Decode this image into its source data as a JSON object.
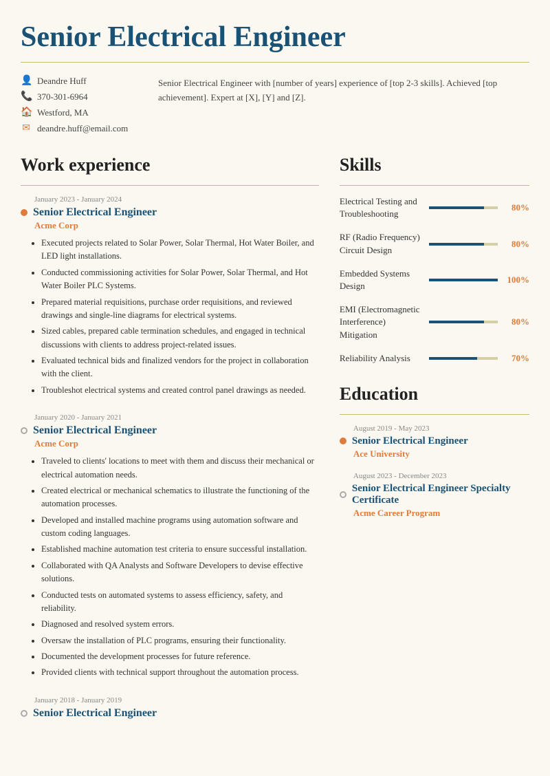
{
  "page": {
    "title": "Senior Electrical Engineer"
  },
  "contact": {
    "name": "Deandre Huff",
    "phone": "370-301-6964",
    "location": "Westford, MA",
    "email": "deandre.huff@email.com"
  },
  "summary": "Senior Electrical Engineer with [number of years] experience of [top 2-3 skills]. Achieved [top achievement]. Expert at [X], [Y] and [Z].",
  "work_experience": {
    "section_title": "Work experience",
    "jobs": [
      {
        "date": "January 2023 - January 2024",
        "title": "Senior Electrical Engineer",
        "company": "Acme Corp",
        "bullet_type": "filled",
        "bullets": [
          "Executed projects related to Solar Power, Solar Thermal, Hot Water Boiler, and LED light installations.",
          "Conducted commissioning activities for Solar Power, Solar Thermal, and Hot Water Boiler PLC Systems.",
          "Prepared material requisitions, purchase order requisitions, and reviewed drawings and single-line diagrams for electrical systems.",
          "Sized cables, prepared cable termination schedules, and engaged in technical discussions with clients to address project-related issues.",
          "Evaluated technical bids and finalized vendors for the project in collaboration with the client.",
          "Troubleshot electrical systems and created control panel drawings as needed."
        ]
      },
      {
        "date": "January 2020 - January 2021",
        "title": "Senior Electrical Engineer",
        "company": "Acme Corp",
        "bullet_type": "outline",
        "bullets": [
          "Traveled to clients' locations to meet with them and discuss their mechanical or electrical automation needs.",
          "Created electrical or mechanical schematics to illustrate the functioning of the automation processes.",
          "Developed and installed machine programs using automation software and custom coding languages.",
          "Established machine automation test criteria to ensure successful installation.",
          "Collaborated with QA Analysts and Software Developers to devise effective solutions.",
          "Conducted tests on automated systems to assess efficiency, safety, and reliability.",
          "Diagnosed and resolved system errors.",
          "Oversaw the installation of PLC programs, ensuring their functionality.",
          "Documented the development processes for future reference.",
          "Provided clients with technical support throughout the automation process."
        ]
      },
      {
        "date": "January 2018 - January 2019",
        "title": "Senior Electrical Engineer",
        "company": "",
        "bullet_type": "outline",
        "bullets": []
      }
    ]
  },
  "skills": {
    "section_title": "Skills",
    "items": [
      {
        "name": "Electrical Testing and Troubleshooting",
        "percent": 80,
        "label": "80%"
      },
      {
        "name": "RF (Radio Frequency) Circuit Design",
        "percent": 80,
        "label": "80%"
      },
      {
        "name": "Embedded Systems Design",
        "percent": 100,
        "label": "100%"
      },
      {
        "name": "EMI (Electromagnetic Interference) Mitigation",
        "percent": 80,
        "label": "80%"
      },
      {
        "name": "Reliability Analysis",
        "percent": 70,
        "label": "70%"
      }
    ]
  },
  "education": {
    "section_title": "Education",
    "entries": [
      {
        "date": "August 2019 - May 2023",
        "title": "Senior Electrical Engineer",
        "school": "Ace University",
        "bullet_type": "filled"
      },
      {
        "date": "August 2023 - December 2023",
        "title": "Senior Electrical Engineer Specialty Certificate",
        "school": "Acme Career Program",
        "bullet_type": "outline"
      }
    ]
  },
  "icons": {
    "person": "👤",
    "phone": "📞",
    "location": "🏠",
    "email": "✉"
  }
}
